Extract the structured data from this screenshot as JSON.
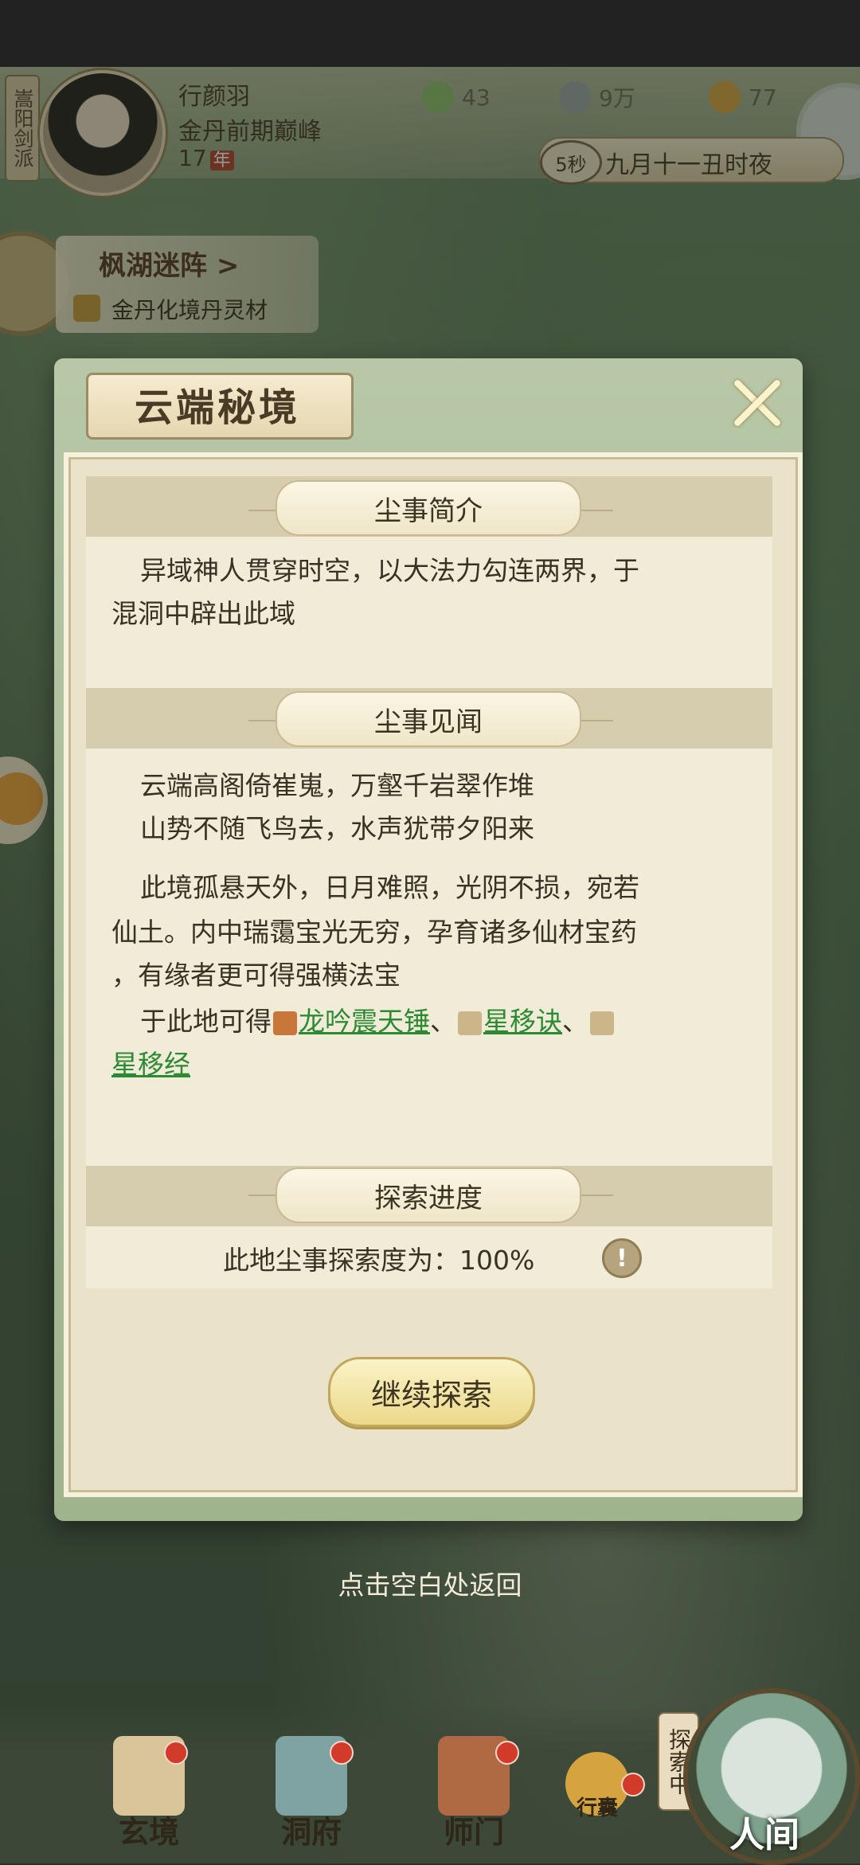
{
  "hud": {
    "sect": "嵩阳剑派",
    "player_name": "行颜羽",
    "player_rank": "金丹前期巅峰",
    "player_age": "17",
    "age_unit": "年",
    "res1": "43",
    "res2": "9万",
    "res3": "77",
    "timer": "5秒",
    "game_time": "九月十一丑时夜"
  },
  "quest": {
    "title": "枫湖迷阵",
    "title_arrow": ">",
    "subtitle": "金丹化境丹灵材"
  },
  "dialog": {
    "title": "云端秘境",
    "intro_label": "尘事简介",
    "intro_line1": "异域神人贯穿时空，以大法力勾连两界，于",
    "intro_line2": "混洞中辟出此域",
    "lore_label": "尘事见闻",
    "poem1": "云端高阁倚崔嵬，万壑千岩翠作堆",
    "poem2": "山势不随飞鸟去，水声犹带夕阳来",
    "desc1": "此境孤悬天外，日月难照，光阴不损，宛若",
    "desc2": "仙土。内中瑞霭宝光无穷，孕育诸多仙材宝药",
    "desc3": "，有缘者更可得强横法宝",
    "obtain_prefix": "于此地可得",
    "item1": "龙吟震天锤",
    "sep": "、",
    "item2": "星移诀",
    "item3": "星移经",
    "progress_label": "探索进度",
    "progress_text": "此地尘事探索度为：100%",
    "info_symbol": "!",
    "continue_label": "继续探索",
    "tap_hint": "点击空白处返回"
  },
  "nav": {
    "items": [
      "玄境",
      "洞府",
      "师门",
      "行囊"
    ],
    "explore_badge": "探索中",
    "world": "人间"
  },
  "colors": {
    "accent_link": "#2c8a35",
    "badge_red": "#d13b2a"
  }
}
